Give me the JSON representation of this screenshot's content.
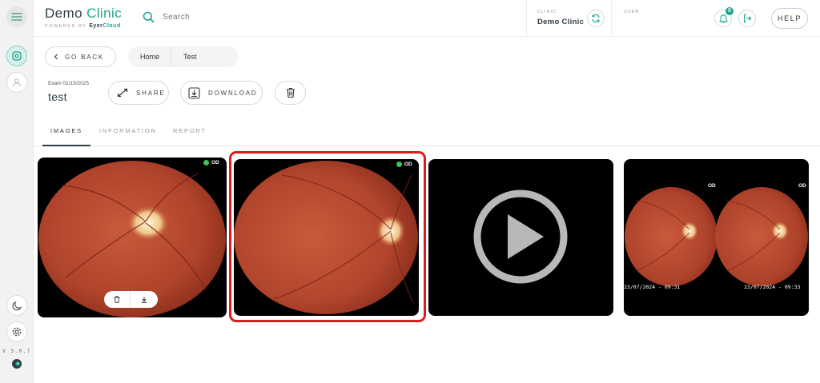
{
  "sidebar": {
    "version": "V 3.0.7",
    "icons": [
      "menu-icon",
      "patients-icon",
      "user-icon",
      "dark-mode-icon",
      "settings-icon",
      "eyer-logo-icon"
    ]
  },
  "header": {
    "brand_primary": "Demo",
    "brand_accent": "Clinic",
    "powered_by": "POWERED BY",
    "powered_brand_a": "Eyer",
    "powered_brand_b": "Cloud",
    "search_placeholder": "Search",
    "clinic_label": "CLINIC",
    "clinic_name": "Demo Clinic",
    "user_label": "USER",
    "notification_count": "0",
    "help_label": "HELP"
  },
  "toolbar": {
    "back_label": "GO BACK",
    "breadcrumb": [
      "Home",
      "Test"
    ],
    "exam_label": "Exam 01/15/2025",
    "exam_title": "test",
    "share_label": "SHARE",
    "download_label": "DOWNLOAD"
  },
  "tabs": [
    {
      "label": "IMAGES",
      "active": true
    },
    {
      "label": "INFORMATION",
      "active": false
    },
    {
      "label": "REPORT",
      "active": false
    }
  ],
  "images": [
    {
      "kind": "fundus",
      "eye": "OD",
      "selected": false
    },
    {
      "kind": "fundus",
      "eye": "OD",
      "selected": true
    },
    {
      "kind": "video",
      "selected": false
    },
    {
      "kind": "fundus-pair",
      "eyes": [
        "OD",
        "OD"
      ],
      "timestamps": [
        "23/07/2024 - 09:31",
        "23/07/2024 - 09:33"
      ],
      "selected": false
    }
  ],
  "colors": {
    "accent": "#1fa58f",
    "brand_dark": "#2f3e46",
    "selection": "#e0191c",
    "eye_dot": "#3ec25a",
    "retina": "#b4432c"
  }
}
